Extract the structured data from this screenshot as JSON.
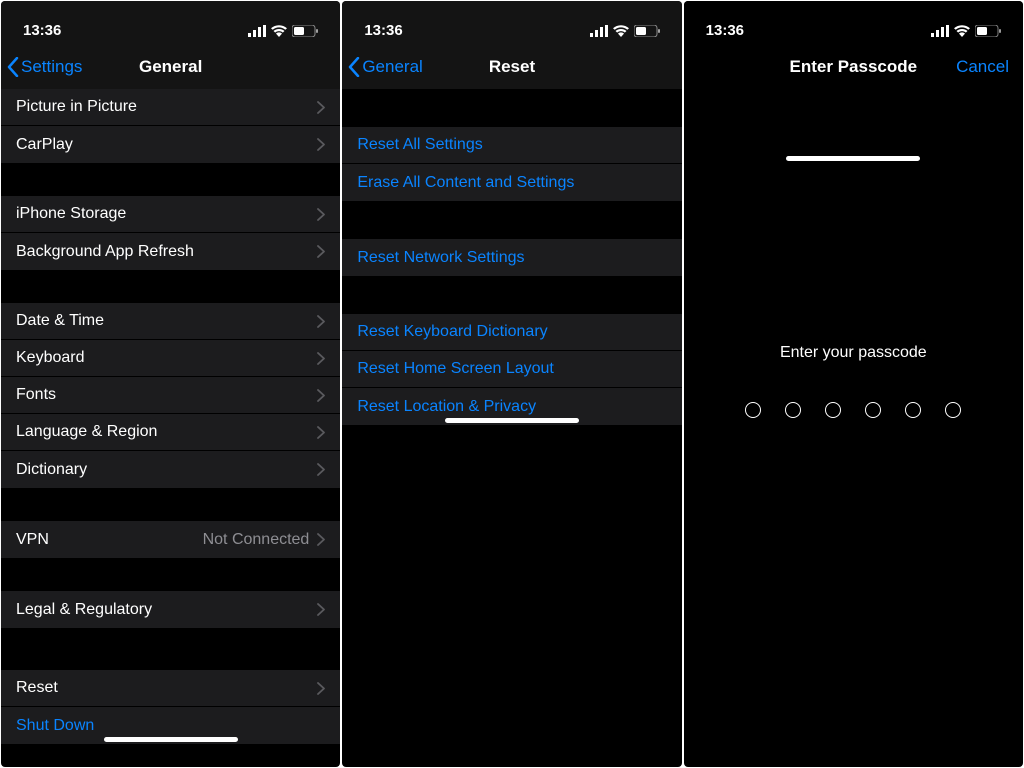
{
  "status": {
    "time": "13:36"
  },
  "screen1": {
    "back": "Settings",
    "title": "General",
    "rows": {
      "pip": "Picture in Picture",
      "carplay": "CarPlay",
      "storage": "iPhone Storage",
      "bar": "Background App Refresh",
      "date": "Date & Time",
      "keyboard": "Keyboard",
      "fonts": "Fonts",
      "lang": "Language & Region",
      "dict": "Dictionary",
      "vpn": "VPN",
      "vpn_status": "Not Connected",
      "legal": "Legal & Regulatory",
      "reset": "Reset",
      "shutdown": "Shut Down"
    }
  },
  "screen2": {
    "back": "General",
    "title": "Reset",
    "rows": {
      "all": "Reset All Settings",
      "erase": "Erase All Content and Settings",
      "network": "Reset Network Settings",
      "keyboard": "Reset Keyboard Dictionary",
      "home": "Reset Home Screen Layout",
      "location": "Reset Location & Privacy"
    }
  },
  "screen3": {
    "title": "Enter Passcode",
    "cancel": "Cancel",
    "prompt": "Enter your passcode"
  }
}
